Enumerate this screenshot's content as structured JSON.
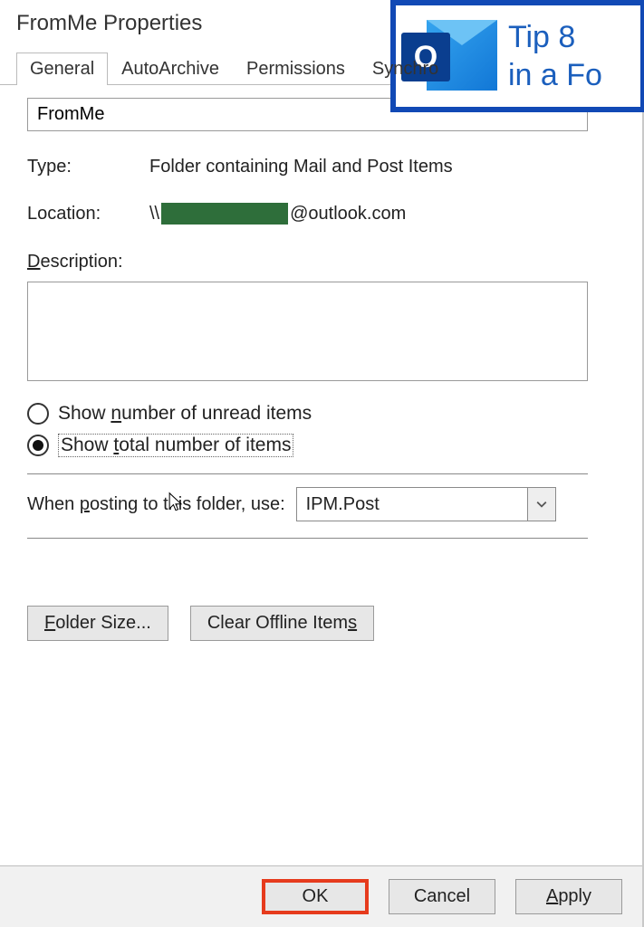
{
  "window": {
    "title": "FromMe Properties"
  },
  "tabs": [
    "General",
    "AutoArchive",
    "Permissions",
    "Synchro"
  ],
  "general": {
    "folder_name": "FromMe",
    "type_label": "Type:",
    "type_value": "Folder containing Mail and Post Items",
    "location_label": "Location:",
    "location_prefix": "\\\\",
    "location_suffix": "@outlook.com",
    "description_label_pre": "",
    "description_label_accel": "D",
    "description_label_post": "escription:",
    "description_value": "",
    "radio_unread_pre": "Show ",
    "radio_unread_accel": "n",
    "radio_unread_post": "umber of unread items",
    "radio_total_pre": "Show ",
    "radio_total_accel": "t",
    "radio_total_post": "otal number of items",
    "posting_pre": "When ",
    "posting_accel": "p",
    "posting_post": "osting to this folder, use:",
    "posting_value": "IPM.Post",
    "folder_size_pre": "",
    "folder_size_accel": "F",
    "folder_size_post": "older Size...",
    "clear_offline_pre": "Clear Offline Item",
    "clear_offline_accel": "s",
    "clear_offline_post": ""
  },
  "buttons": {
    "ok": "OK",
    "cancel": "Cancel",
    "apply_accel": "A",
    "apply_post": "pply"
  },
  "overlay": {
    "icon_letter": "O",
    "line1": "Tip 8",
    "line2": "in a Fo"
  }
}
